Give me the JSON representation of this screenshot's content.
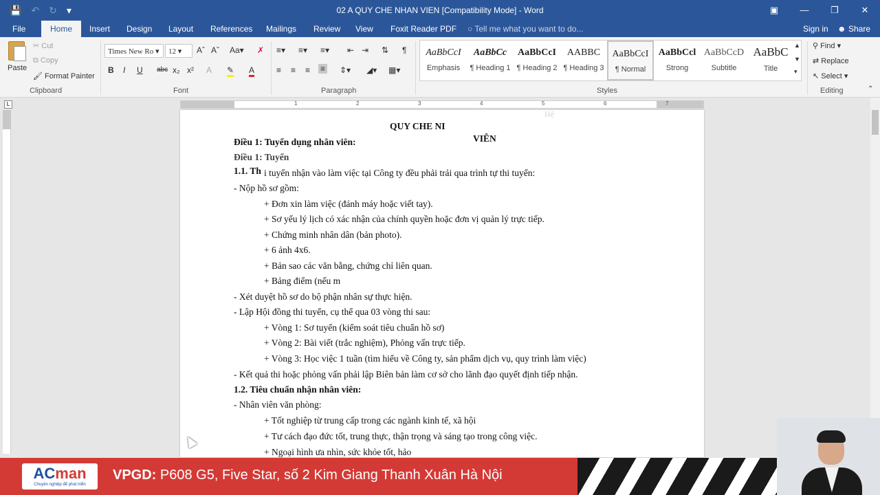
{
  "window": {
    "title": "02 A QUY CHE NHAN VIEN [Compatibility Mode] - Word",
    "controls": [
      "ribbon-display-icon",
      "minimize-icon",
      "restore-icon",
      "close-icon"
    ]
  },
  "qat": {
    "icons": [
      "save-icon",
      "undo-icon",
      "redo-icon",
      "customize-icon"
    ]
  },
  "tabs": {
    "file": "File",
    "home": "Home",
    "insert": "Insert",
    "design": "Design",
    "layout": "Layout",
    "references": "References",
    "mailings": "Mailings",
    "review": "Review",
    "view": "View",
    "foxit": "Foxit Reader PDF",
    "tellme": "Tell me what you want to do...",
    "signin": "Sign in",
    "share": "Share"
  },
  "clipboard": {
    "paste": "Paste",
    "cut": "Cut",
    "copy": "Copy",
    "format_painter": "Format Painter",
    "label": "Clipboard"
  },
  "font": {
    "name": "Times New Ro",
    "size": "12",
    "label": "Font"
  },
  "paragraph": {
    "label": "Paragraph"
  },
  "styles": {
    "label": "Styles",
    "items": [
      {
        "sample": "AaBbCcI",
        "name": "Emphasis"
      },
      {
        "sample": "AaBbCc",
        "name": "¶ Heading 1"
      },
      {
        "sample": "AaBbCcI",
        "name": "¶ Heading 2"
      },
      {
        "sample": "AABBC",
        "name": "¶ Heading 3"
      },
      {
        "sample": "AaBbCcI",
        "name": "¶ Normal"
      },
      {
        "sample": "AaBbCcl",
        "name": "Strong"
      },
      {
        "sample": "AaBbCcD",
        "name": "Subtitle"
      },
      {
        "sample": "AaBbC",
        "name": "Title"
      }
    ]
  },
  "editing": {
    "find": "Find",
    "replace": "Replace",
    "select": "Select",
    "label": "Editing"
  },
  "ruler": {
    "numbers": [
      "1",
      "2",
      "3",
      "4",
      "5",
      "6",
      "7"
    ]
  },
  "document": {
    "heading": "QUY CHE NI",
    "heading_tail": "VIÊN",
    "faint_top": "Hệ",
    "dieu1": "Điều 1: Tuyển dụng nhân viên:",
    "dieu1_ghost": "Điều 1: Tuyển",
    "sec11_prefix": "1.1. Th",
    "sec11_text": "i tuyển nhận vào làm việc tại Công ty đều phải trải qua trình tự thi tuyển:",
    "ho_so": "- Nộp hồ sơ gồm:",
    "items": [
      "+ Đơn xin làm việc (đánh máy hoặc viết tay).",
      "+ Sơ yếu lý lịch có xác nhận của chính quyền hoặc đơn vị quản lý trực tiếp.",
      "+ Chứng minh nhân dân (bản photo).",
      "+ 6 ảnh 4x6.",
      "+ Bản sao các văn bằng, chứng chỉ liên quan.",
      "+ Bảng điểm (nếu m"
    ],
    "xet_duyet": "- Xét duyệt hồ sơ do bộ phận nhân sự thực hiện.",
    "lap_hoi_dong": "- Lập Hội đồng thi tuyển, cụ thể qua 03 vòng thi sau:",
    "vong1": "+ Vòng 1: Sơ tuyển (kiểm soát tiêu chuẩn hồ sơ)",
    "vong2": "+ Vòng 2: Bài viết (trắc nghiệm), Phỏng vấn trực tiếp.",
    "vong3": "+ Vòng 3: Học việc 1 tuần (tìm hiểu về Công ty, sản phẩm dịch vụ, quy trình làm việc)",
    "ket_qua": "- Kết quả thi hoặc phỏng vấn phải lập Biên bản làm cơ sở cho lãnh đạo quyết định tiếp nhận.",
    "sec12": "1.2. Tiêu chuẩn nhận nhân viên:",
    "nv_vp": "- Nhân viên văn phòng:",
    "tot_nghiep": "+ Tốt nghiệp từ trung cấp trong các ngành kinh tế, xã hội",
    "tu_cach": "+ Tư cách đạo đức tốt, trung thực, thận trọng và sáng tạo trong công việc.",
    "ngoai_hinh": "+ Ngoại hình ưa nhìn, sức khỏe tốt, hảo"
  },
  "banner": {
    "logo_brand_a": "AC",
    "logo_brand_b": "man",
    "logo_tag": "Chuyên nghiệp để phát triển",
    "label": "VPGD:",
    "address": "P608 G5, Five Star, số 2 Kim Giang Thanh Xuân Hà Nội"
  }
}
